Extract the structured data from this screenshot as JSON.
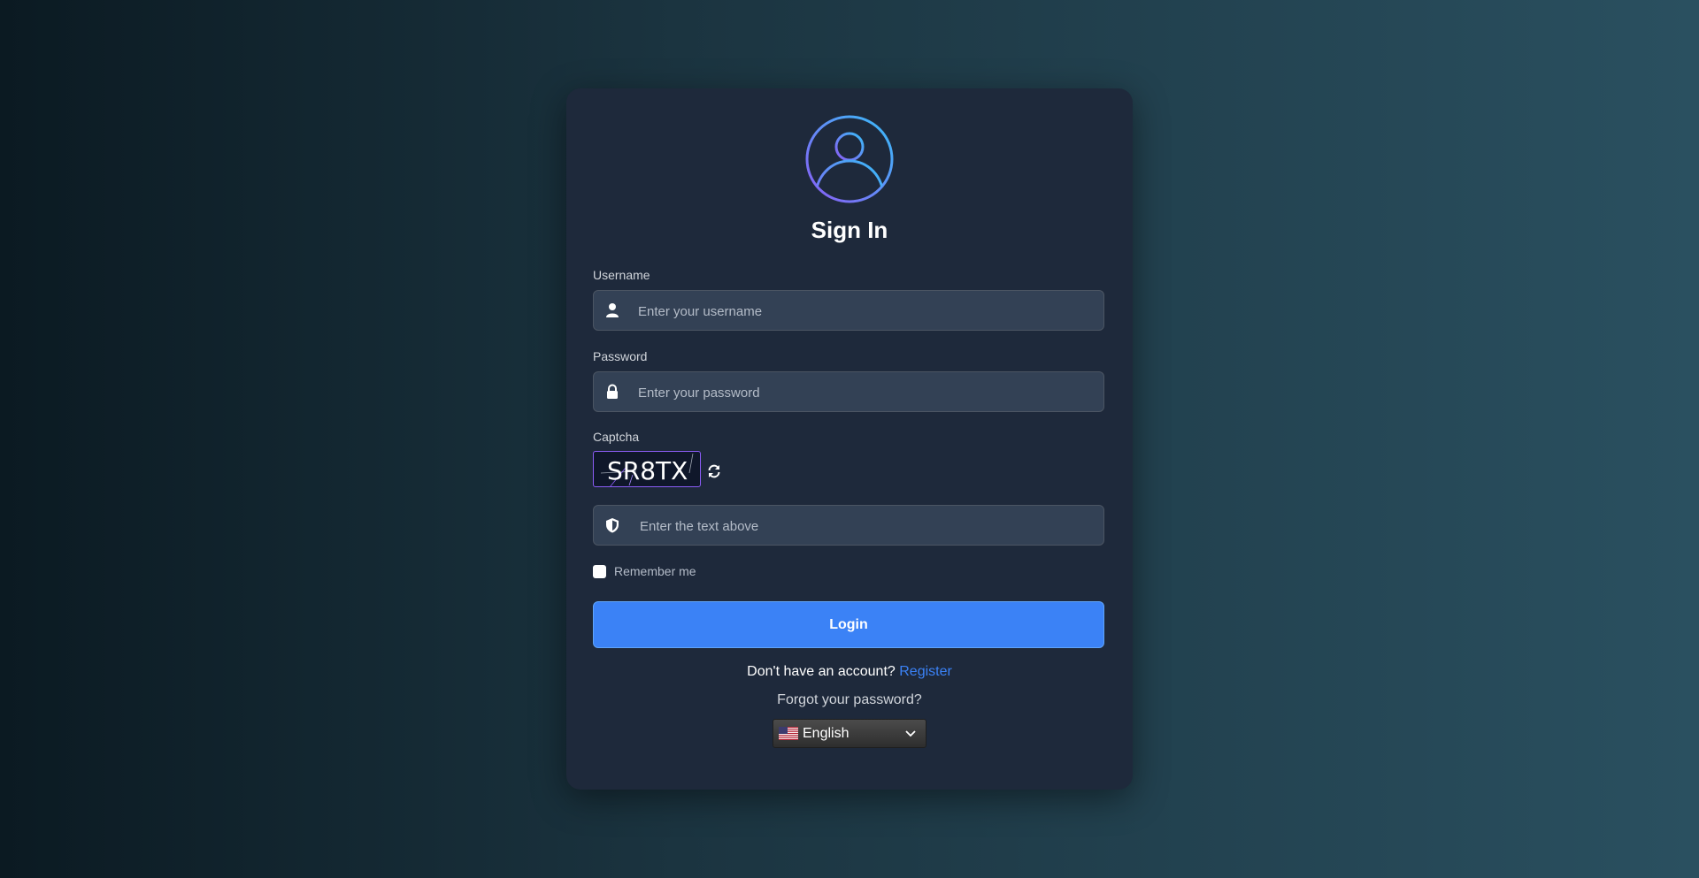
{
  "colors": {
    "accent": "#3b82f6",
    "card": "#1e293b",
    "input_bg": "#334155"
  },
  "form": {
    "title": "Sign In",
    "username": {
      "label": "Username",
      "placeholder": "Enter your username",
      "icon": "user-icon"
    },
    "password": {
      "label": "Password",
      "placeholder": "Enter your password",
      "icon": "lock-icon"
    },
    "captcha": {
      "label": "Captcha",
      "code": "SR8TX",
      "placeholder": "Enter the text above",
      "icon": "shield-icon",
      "refresh_icon": "refresh-icon"
    },
    "remember_label": "Remember me",
    "login_label": "Login",
    "signup_prompt": "Don't have an account?",
    "register_label": "Register",
    "forgot_label": "Forgot your password?",
    "language": {
      "selected": "English",
      "flag": "us-flag-icon"
    }
  }
}
